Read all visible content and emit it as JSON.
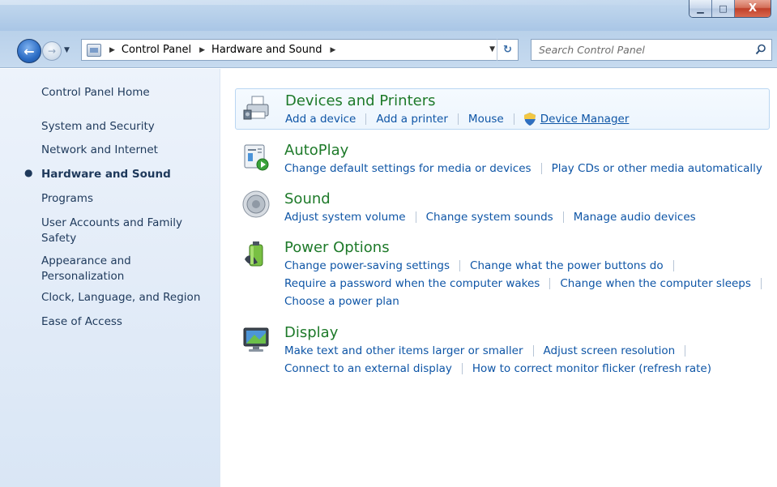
{
  "window": {
    "minimize_glyph": "▁",
    "maximize_glyph": "□",
    "close_glyph": "X"
  },
  "address": {
    "back_glyph": "←",
    "forward_glyph": "→",
    "breadcrumbs": [
      "Control Panel",
      "Hardware and Sound"
    ],
    "search_placeholder": "Search Control Panel"
  },
  "sidebar": {
    "items": [
      {
        "label": "Control Panel Home"
      },
      {
        "label": "System and Security"
      },
      {
        "label": "Network and Internet"
      },
      {
        "label": "Hardware and Sound",
        "active": true
      },
      {
        "label": "Programs"
      },
      {
        "label": "User Accounts and Family Safety",
        "line1": "User Accounts and Family",
        "line2": "Safety"
      },
      {
        "label": "Appearance and Personalization",
        "line1": "Appearance and",
        "line2": "Personalization"
      },
      {
        "label": "Clock, Language, and Region"
      },
      {
        "label": "Ease of Access"
      }
    ]
  },
  "categories": [
    {
      "title": "Devices and Printers",
      "icon": "printer-icon",
      "links": [
        "Add a device",
        "Add a printer",
        "Mouse",
        "Device Manager"
      ]
    },
    {
      "title": "AutoPlay",
      "icon": "autoplay-icon",
      "links": [
        "Change default settings for media or devices",
        "Play CDs or other media automatically"
      ]
    },
    {
      "title": "Sound",
      "icon": "speaker-icon",
      "links": [
        "Adjust system volume",
        "Change system sounds",
        "Manage audio devices"
      ]
    },
    {
      "title": "Power Options",
      "icon": "battery-icon",
      "links": [
        "Change power-saving settings",
        "Change what the power buttons do",
        "Require a password when the computer wakes",
        "Change when the computer sleeps",
        "Choose a power plan"
      ]
    },
    {
      "title": "Display",
      "icon": "monitor-icon",
      "links": [
        "Make text and other items larger or smaller",
        "Adjust screen resolution",
        "Connect to an external display",
        "How to correct monitor flicker (refresh rate)"
      ]
    }
  ],
  "colors": {
    "category_title": "#1e7a2a",
    "link": "#0e55a6",
    "sidebar_text": "#1e395b"
  }
}
